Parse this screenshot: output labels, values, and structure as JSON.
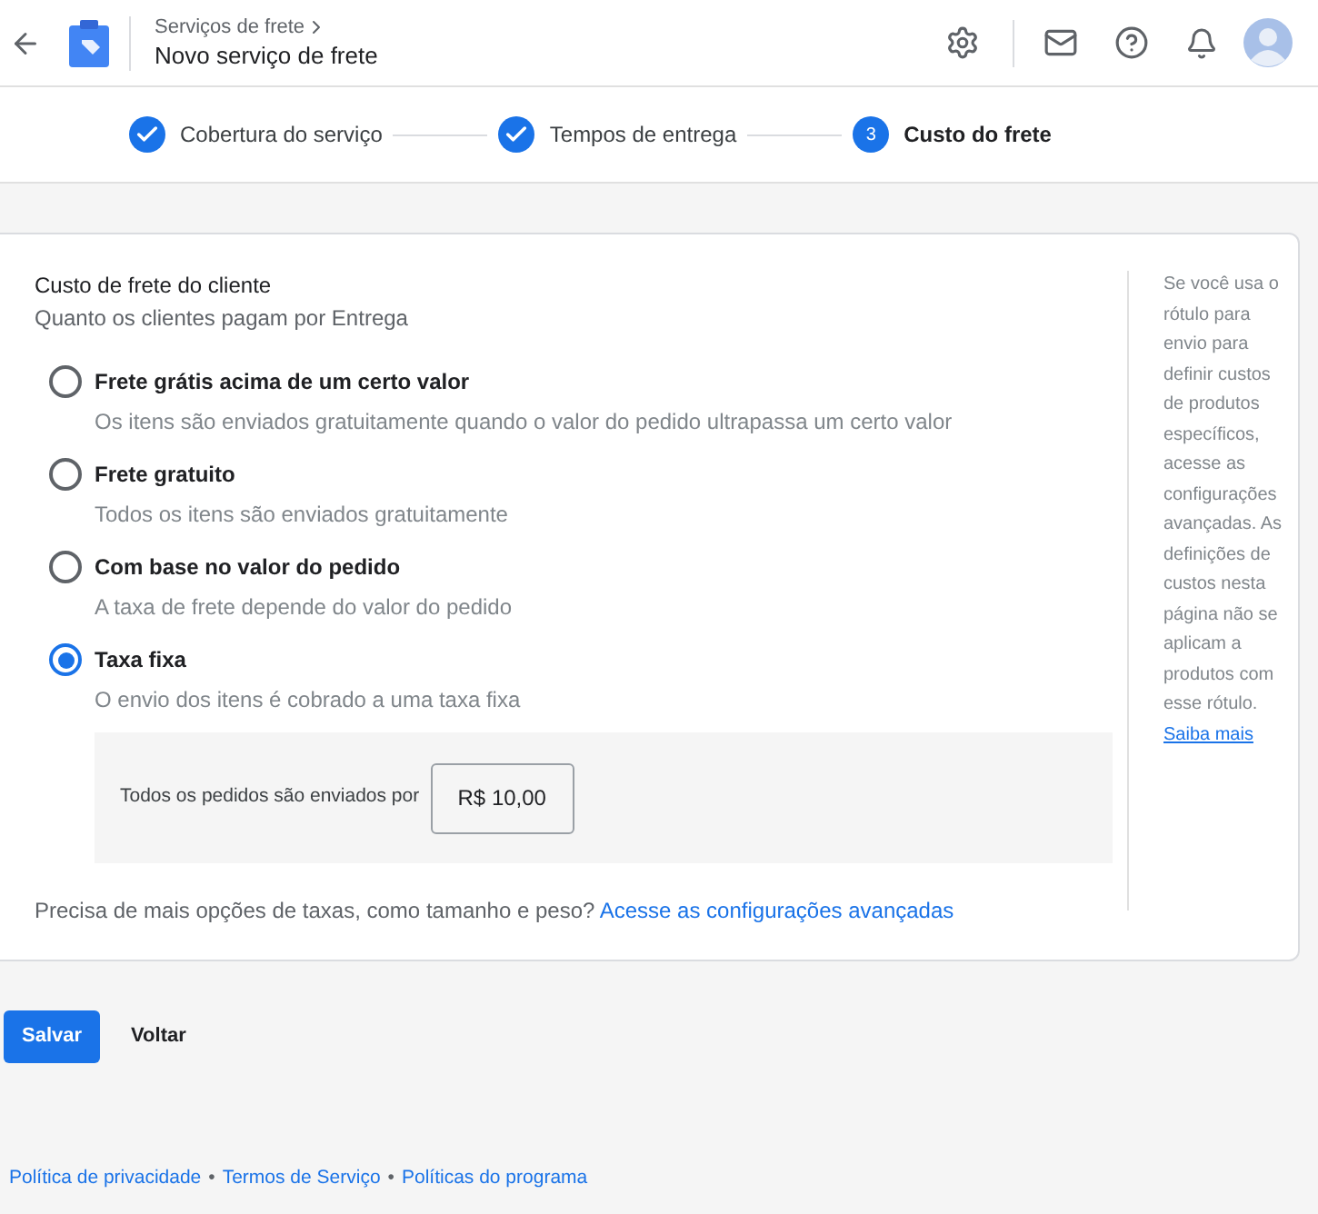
{
  "header": {
    "breadcrumb": "Serviços de frete",
    "title": "Novo serviço de frete"
  },
  "steps": [
    {
      "label": "Cobertura do serviço",
      "done": true,
      "current": false
    },
    {
      "label": "Tempos de entrega",
      "done": true,
      "current": false
    },
    {
      "label": "Custo do frete",
      "done": false,
      "current": true,
      "number": "3"
    }
  ],
  "section": {
    "title": "Custo de frete do cliente",
    "subtitle": "Quanto os clientes pagam por Entrega"
  },
  "options": [
    {
      "label": "Frete grátis acima de um certo valor",
      "description": "Os itens são enviados gratuitamente quando o valor do pedido ultrapassa um certo valor",
      "selected": false
    },
    {
      "label": "Frete gratuito",
      "description": "Todos os itens são enviados gratuitamente",
      "selected": false
    },
    {
      "label": "Com base no valor do pedido",
      "description": "A taxa de frete depende do valor do pedido",
      "selected": false
    },
    {
      "label": "Taxa fixa",
      "description": "O envio dos itens é cobrado a uma taxa fixa",
      "selected": true
    }
  ],
  "rate": {
    "label": "Todos os pedidos são enviados por",
    "value": "R$ 10,00"
  },
  "advanced": {
    "text": "Precisa de mais opções de taxas, como tamanho e peso?",
    "link": "Acesse as configurações avançadas"
  },
  "side_note": {
    "text": "Se você usa o rótulo para envio para definir custos de produtos específicos, acesse as configurações avançadas. As definições de custos nesta página não se aplicam a produtos com esse rótulo.",
    "link": "Saiba mais"
  },
  "buttons": {
    "save": "Salvar",
    "back": "Voltar"
  },
  "footer": {
    "links": [
      "Política de privacidade",
      "Termos de Serviço",
      "Políticas do programa"
    ],
    "separator": "•"
  }
}
